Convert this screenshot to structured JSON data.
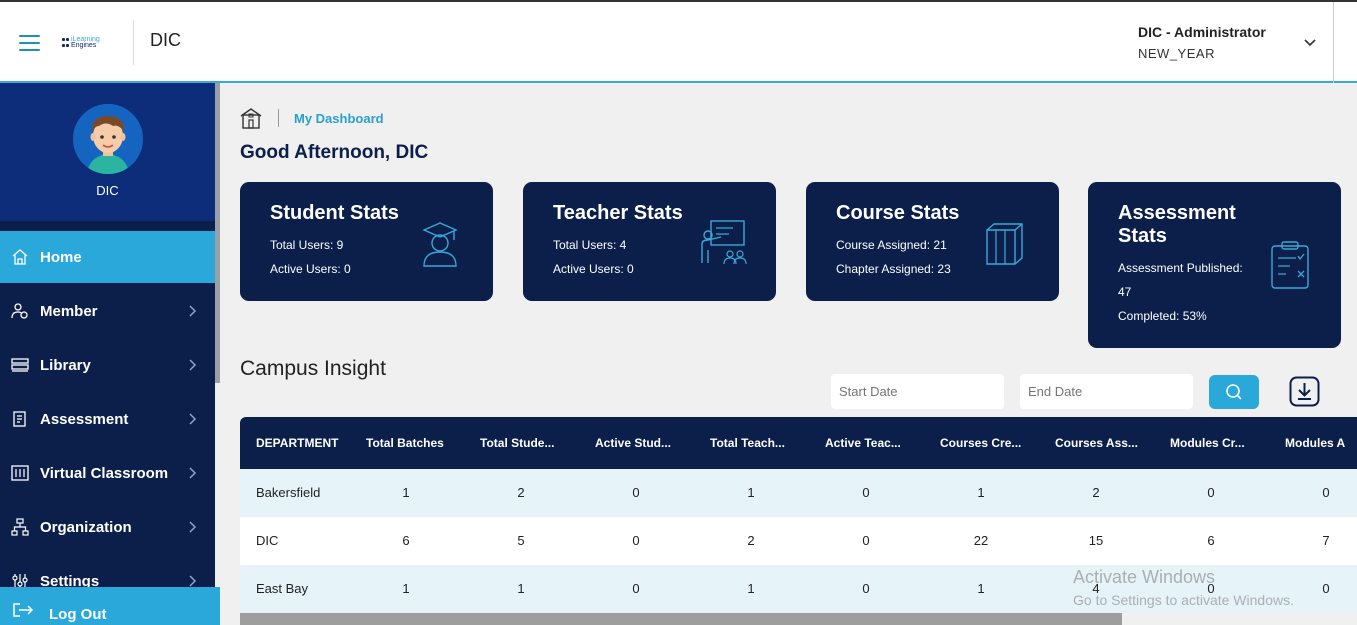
{
  "header": {
    "logo_text_1": "iLearning",
    "logo_text_2": "Engines",
    "app_title": "DIC",
    "user_name": "DIC - Administrator",
    "user_sub": "NEW_YEAR"
  },
  "sidebar": {
    "profile_name": "DIC",
    "items": [
      {
        "label": "Home",
        "icon": "home-icon"
      },
      {
        "label": "Member",
        "icon": "member-icon"
      },
      {
        "label": "Library",
        "icon": "library-icon"
      },
      {
        "label": "Assessment",
        "icon": "assessment-icon"
      },
      {
        "label": "Virtual Classroom",
        "icon": "virtual-classroom-icon"
      },
      {
        "label": "Organization",
        "icon": "organization-icon"
      },
      {
        "label": "Settings",
        "icon": "settings-icon"
      }
    ],
    "logout_label": "Log Out"
  },
  "main": {
    "breadcrumb": "My Dashboard",
    "greeting": "Good Afternoon, DIC",
    "cards": [
      {
        "title": "Student Stats",
        "line1": "Total Users: 9",
        "line2": "Active Users: 0"
      },
      {
        "title": "Teacher Stats",
        "line1": "Total Users: 4",
        "line2": "Active Users: 0"
      },
      {
        "title": "Course Stats",
        "line1": "Course Assigned: 21",
        "line2": "Chapter Assigned: 23"
      },
      {
        "title": "Assessment Stats",
        "line1": "Assessment Published:",
        "line2": "47",
        "line3": "Completed: 53%"
      }
    ],
    "section_title": "Campus Insight",
    "start_date_placeholder": "Start Date",
    "end_date_placeholder": "End Date"
  },
  "table": {
    "headers": [
      "DEPARTMENT",
      "Total Batches",
      "Total Stude...",
      "Active Stud...",
      "Total Teach...",
      "Active Teac...",
      "Courses Cre...",
      "Courses Ass...",
      "Modules Cr...",
      "Modules A"
    ],
    "rows": [
      [
        "Bakersfield",
        "1",
        "2",
        "0",
        "1",
        "0",
        "1",
        "2",
        "0",
        "0"
      ],
      [
        "DIC",
        "6",
        "5",
        "0",
        "2",
        "0",
        "22",
        "15",
        "6",
        "7"
      ],
      [
        "East Bay",
        "1",
        "1",
        "0",
        "1",
        "0",
        "1",
        "4",
        "0",
        "0"
      ]
    ]
  },
  "watermark": {
    "line1": "Activate Windows",
    "line2": "Go to Settings to activate Windows."
  },
  "colors": {
    "navy": "#0b1f4a",
    "accent": "#29a8d9",
    "profile_bg": "#0d2d7a"
  }
}
